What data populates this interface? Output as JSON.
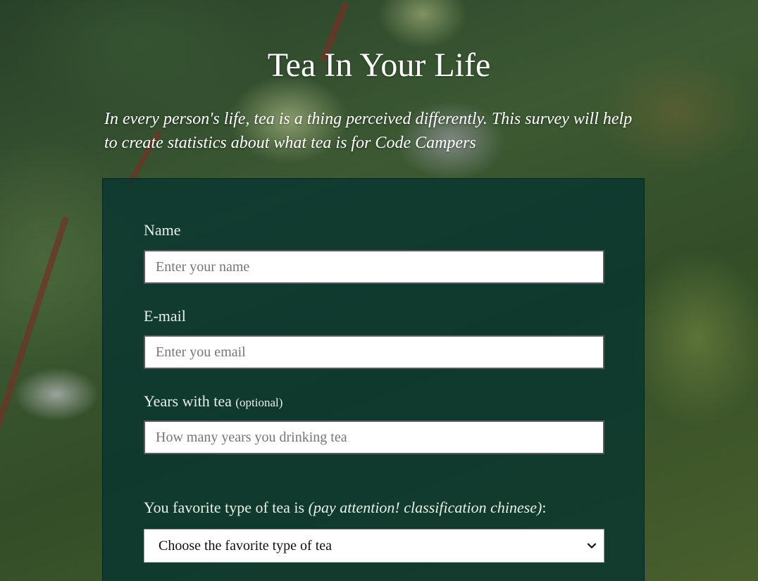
{
  "header": {
    "title": "Tea In Your Life",
    "description": "In every person's life, tea is a thing perceived differently. This survey will help to create statistics about what tea is for Code Campers"
  },
  "form": {
    "name": {
      "label": "Name",
      "placeholder": "Enter your name"
    },
    "email": {
      "label": "E-mail",
      "placeholder": "Enter you email"
    },
    "years": {
      "label": "Years with tea",
      "optional_note": "(optional)",
      "placeholder": "How many years you drinking tea"
    },
    "favorite": {
      "label_start": "You favorite type of tea is",
      "label_note": "(pay attention! classification chinese)",
      "label_end": ":",
      "selected": "Choose the favorite type of tea"
    }
  },
  "icons": {
    "select_chevron": "chevron-down-icon"
  }
}
